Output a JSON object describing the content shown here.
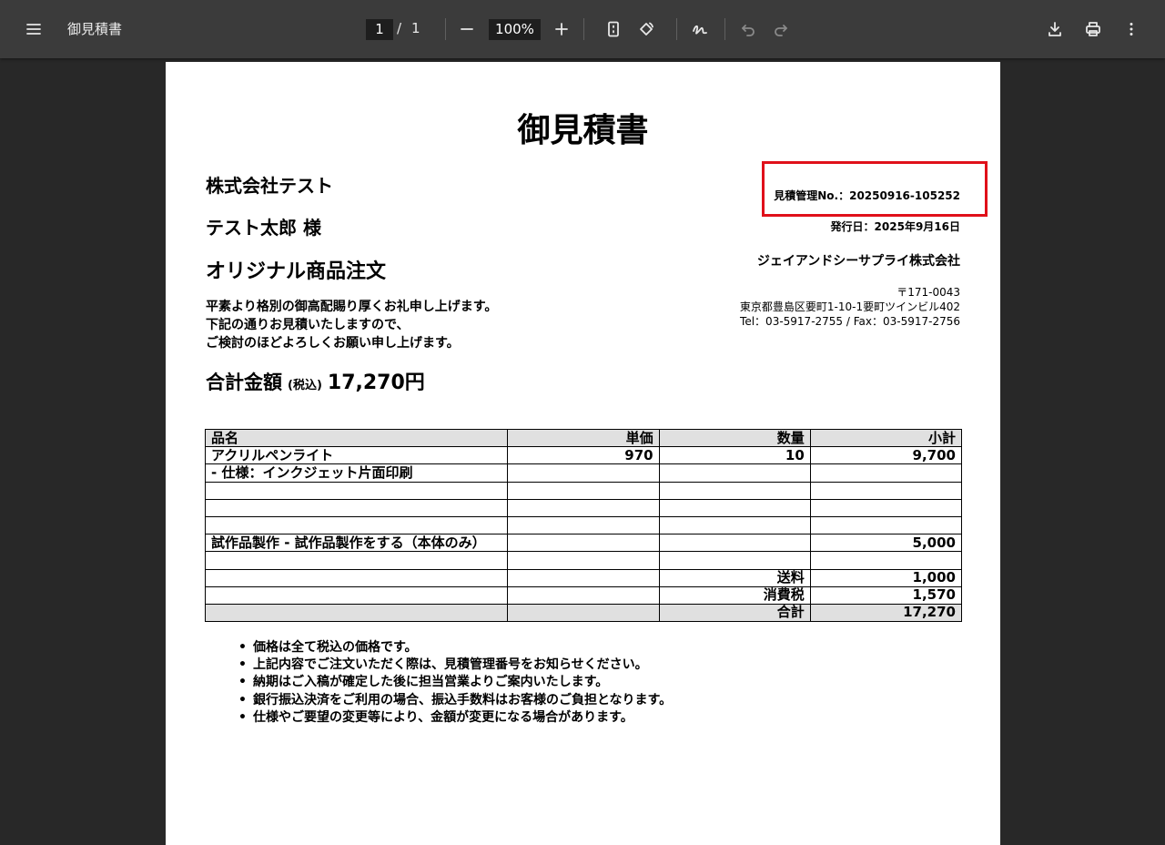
{
  "toolbar": {
    "title": "御見積書",
    "page_current": "1",
    "page_sep": "/",
    "page_total": "1",
    "zoom": "100%"
  },
  "document": {
    "heading": "御見積書",
    "client_company": "株式会社テスト",
    "client_person": "テスト太郎 様",
    "subject": "オリジナル商品注文",
    "greeting": [
      "平素より格別の御高配賜り厚くお礼申し上げます。",
      "下記の通りお見積いたしますので、",
      "ご検討のほどよろしくお願い申し上げます。"
    ],
    "total_label": "合計金額",
    "total_tax": "(税込)",
    "total_amount": "17,270円",
    "estimate_no": "見積管理No.：20250916-105252",
    "issue_date": "発行日：2025年9月16日",
    "supplier": "ジェイアンドシーサプライ株式会社",
    "postal": "〒171-0043",
    "address": "東京都豊島区要町1-10-1要町ツインビル402",
    "tel_fax": "Tel：03-5917-2755 / Fax：03-5917-2756"
  },
  "table": {
    "headers": [
      "品名",
      "単価",
      "数量",
      "小計"
    ],
    "rows": [
      [
        "アクリルペンライト",
        "970",
        "10",
        "9,700"
      ],
      [
        "- 仕様：インクジェット片面印刷",
        "",
        "",
        ""
      ],
      [
        "",
        "",
        "",
        ""
      ],
      [
        "",
        "",
        "",
        ""
      ],
      [
        "",
        "",
        "",
        ""
      ],
      [
        "試作品製作 - 試作品製作をする（本体のみ）",
        "",
        "",
        "5,000"
      ],
      [
        "",
        "",
        "",
        ""
      ],
      [
        "",
        "",
        "送料",
        "1,000"
      ],
      [
        "",
        "",
        "消費税",
        "1,570"
      ],
      [
        "",
        "",
        "合計",
        "17,270"
      ]
    ]
  },
  "notes": [
    "価格は全て税込の価格です。",
    "上記内容でご注文いただく際は、見積管理番号をお知らせください。",
    "納期はご入稿が確定した後に担当営業よりご案内いたします。",
    "銀行振込決済をご利用の場合、振込手数料はお客様のご負担となります。",
    "仕様やご要望の変更等により、金額が変更になる場合があります。"
  ],
  "highlight_color": "#e0101a"
}
